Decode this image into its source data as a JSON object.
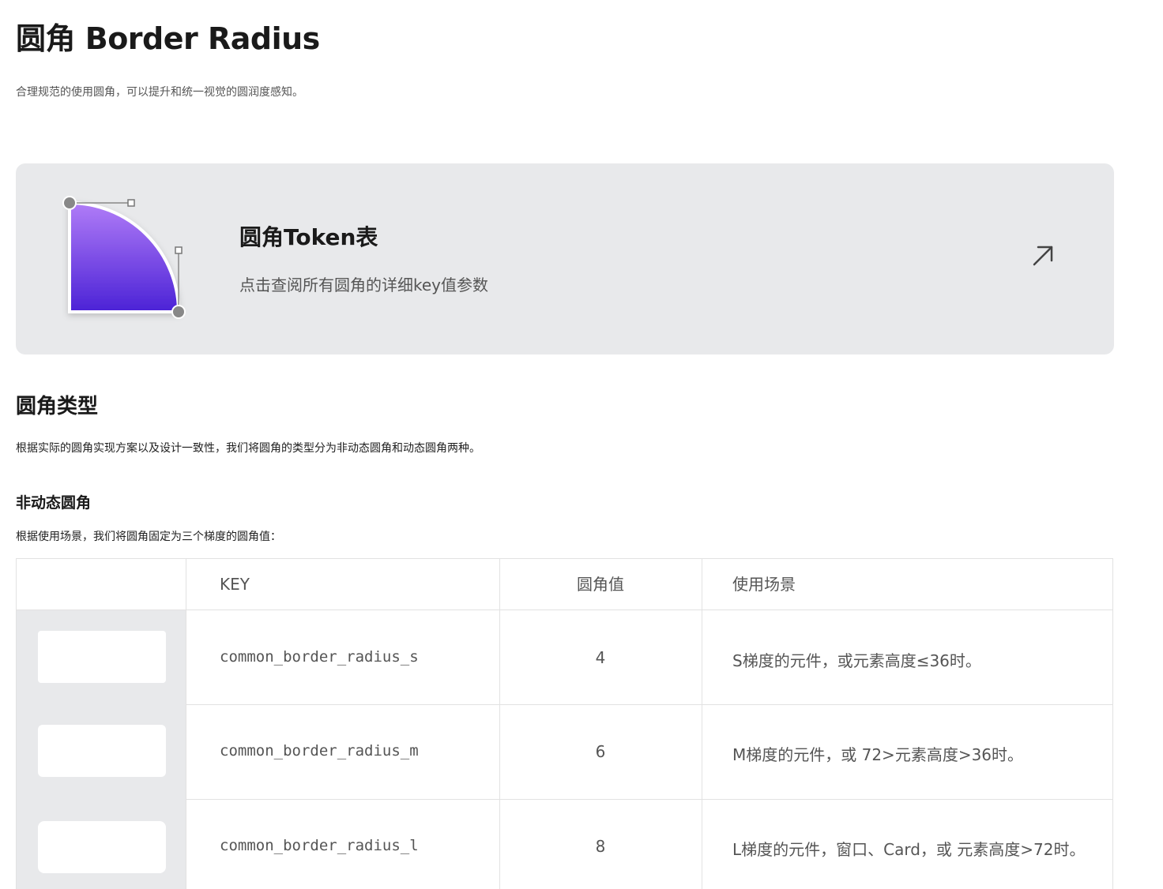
{
  "page": {
    "title": "圆角 Border Radius",
    "description": "合理规范的使用圆角，可以提升和统一视觉的圆润度感知。"
  },
  "token_card": {
    "title": "圆角Token表",
    "subtitle": "点击查阅所有圆角的详细key值参数",
    "illustration_icon": "rounded-corner-illustration",
    "arrow_icon": "arrow-up-right-icon",
    "gradient_top": "#b07cf7",
    "gradient_bottom": "#4b22d6"
  },
  "section": {
    "title": "圆角类型",
    "description": "根据实际的圆角实现方案以及设计一致性，我们将圆角的类型分为非动态圆角和动态圆角两种。"
  },
  "subsection": {
    "title": "非动态圆角",
    "description": "根据使用场景，我们将圆角固定为三个梯度的圆角值："
  },
  "table": {
    "headers": {
      "preview": "",
      "key": "KEY",
      "value": "圆角值",
      "usage": "使用场景"
    },
    "rows": [
      {
        "key": "common_border_radius_s",
        "value": "4",
        "usage": "S梯度的元件，或元素高度≤36时。"
      },
      {
        "key": "common_border_radius_m",
        "value": "6",
        "usage": "M梯度的元件，或 72>元素高度>36时。"
      },
      {
        "key": "common_border_radius_l",
        "value": "8",
        "usage": "L梯度的元件，窗口、Card，或 元素高度>72时。"
      }
    ]
  }
}
